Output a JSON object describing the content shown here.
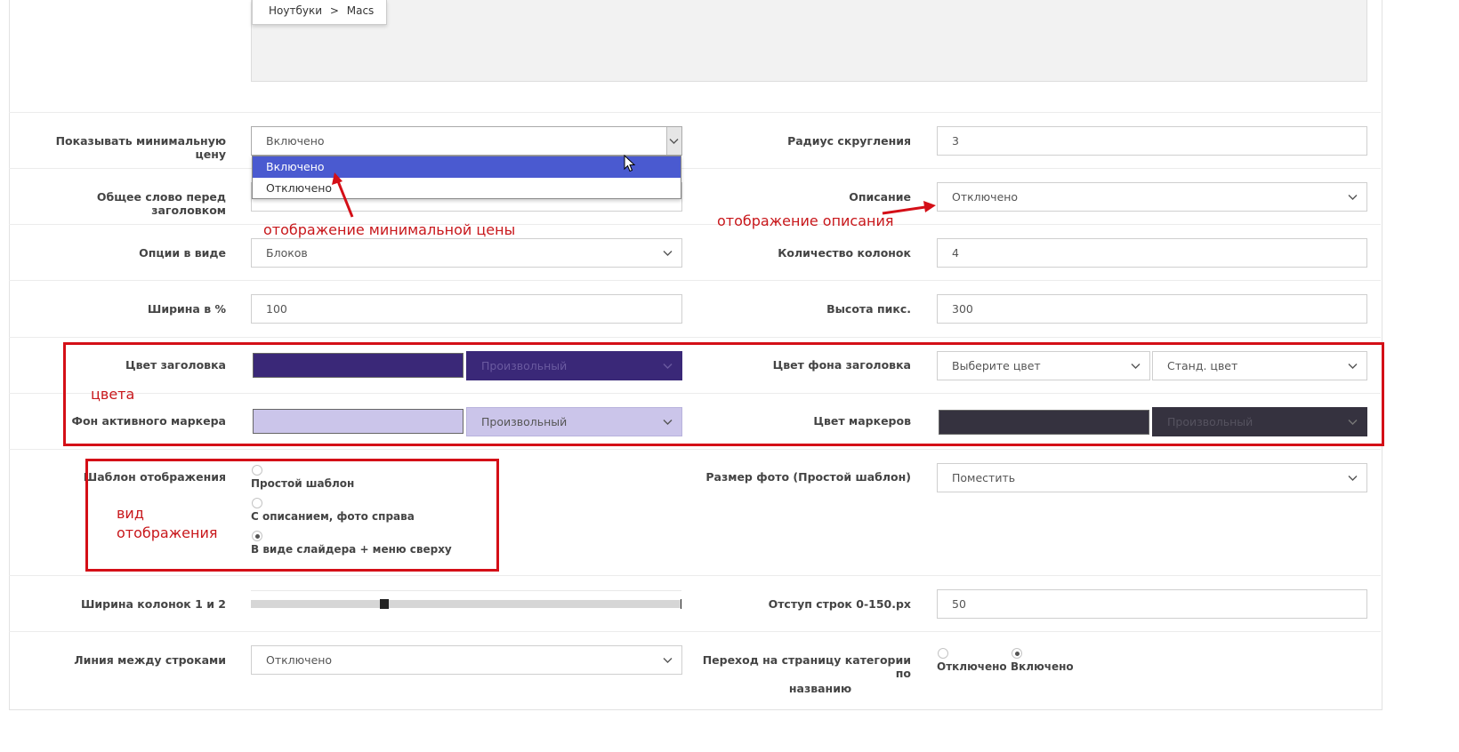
{
  "breadcrumb": {
    "part1": "Ноутбуки",
    "sep": ">",
    "part2": "Macs"
  },
  "rows": {
    "min_price": {
      "label": "Показывать минимальную цену",
      "value": "Включено"
    },
    "radius": {
      "label": "Радиус скругления",
      "value": "3"
    },
    "common_word": {
      "label": "Общее слово перед заголовком"
    },
    "description": {
      "label": "Описание",
      "value": "Отключено"
    },
    "options_view": {
      "label": "Опции в виде",
      "value": "Блоков"
    },
    "columns": {
      "label": "Количество колонок",
      "value": "4"
    },
    "width": {
      "label": "Ширина в %",
      "value": "100"
    },
    "height": {
      "label": "Высота пикс.",
      "value": "300"
    },
    "title_color": {
      "label": "Цвет заголовка",
      "swatch": "#3a2878",
      "select": "Произвольный"
    },
    "title_bg": {
      "label": "Цвет фона заголовка",
      "select1": "Выберите цвет",
      "select2": "Станд. цвет"
    },
    "active_marker": {
      "label": "Фон активного маркера",
      "swatch": "#cbc5ea",
      "select": "Произвольный"
    },
    "marker_color": {
      "label": "Цвет маркеров",
      "swatch": "#35323f",
      "select": "Произвольный"
    },
    "template": {
      "label": "Шаблон отображения",
      "options": [
        "Простой шаблон",
        "С описанием, фото справа",
        "В виде слайдера + меню сверху"
      ],
      "selected": 2
    },
    "photo_size": {
      "label": "Размер фото (Простой шаблон)",
      "value": "Поместить"
    },
    "col_width": {
      "label": "Ширина колонок 1 и 2",
      "slider_fraction": 0.3
    },
    "row_gap": {
      "label": "Отступ строк 0-150.px",
      "value": "50"
    },
    "row_line": {
      "label": "Линия между строками",
      "value": "Отключено"
    },
    "cat_link": {
      "label_line1": "Переход на страницу категории по",
      "label_line2": "названию",
      "options": [
        "Отключено",
        "Включено"
      ],
      "selected": 1
    }
  },
  "dropdown": {
    "options": [
      "Включено",
      "Отключено"
    ],
    "highlighted": 0
  },
  "annotations": {
    "min_price": "отображение минимальной цены",
    "description": "отображение описания",
    "colors": "цвета",
    "view_line1": "вид",
    "view_line2": "отображения"
  },
  "colors": {
    "accent": "#4a5ad0",
    "annotation": "#d40f17"
  }
}
